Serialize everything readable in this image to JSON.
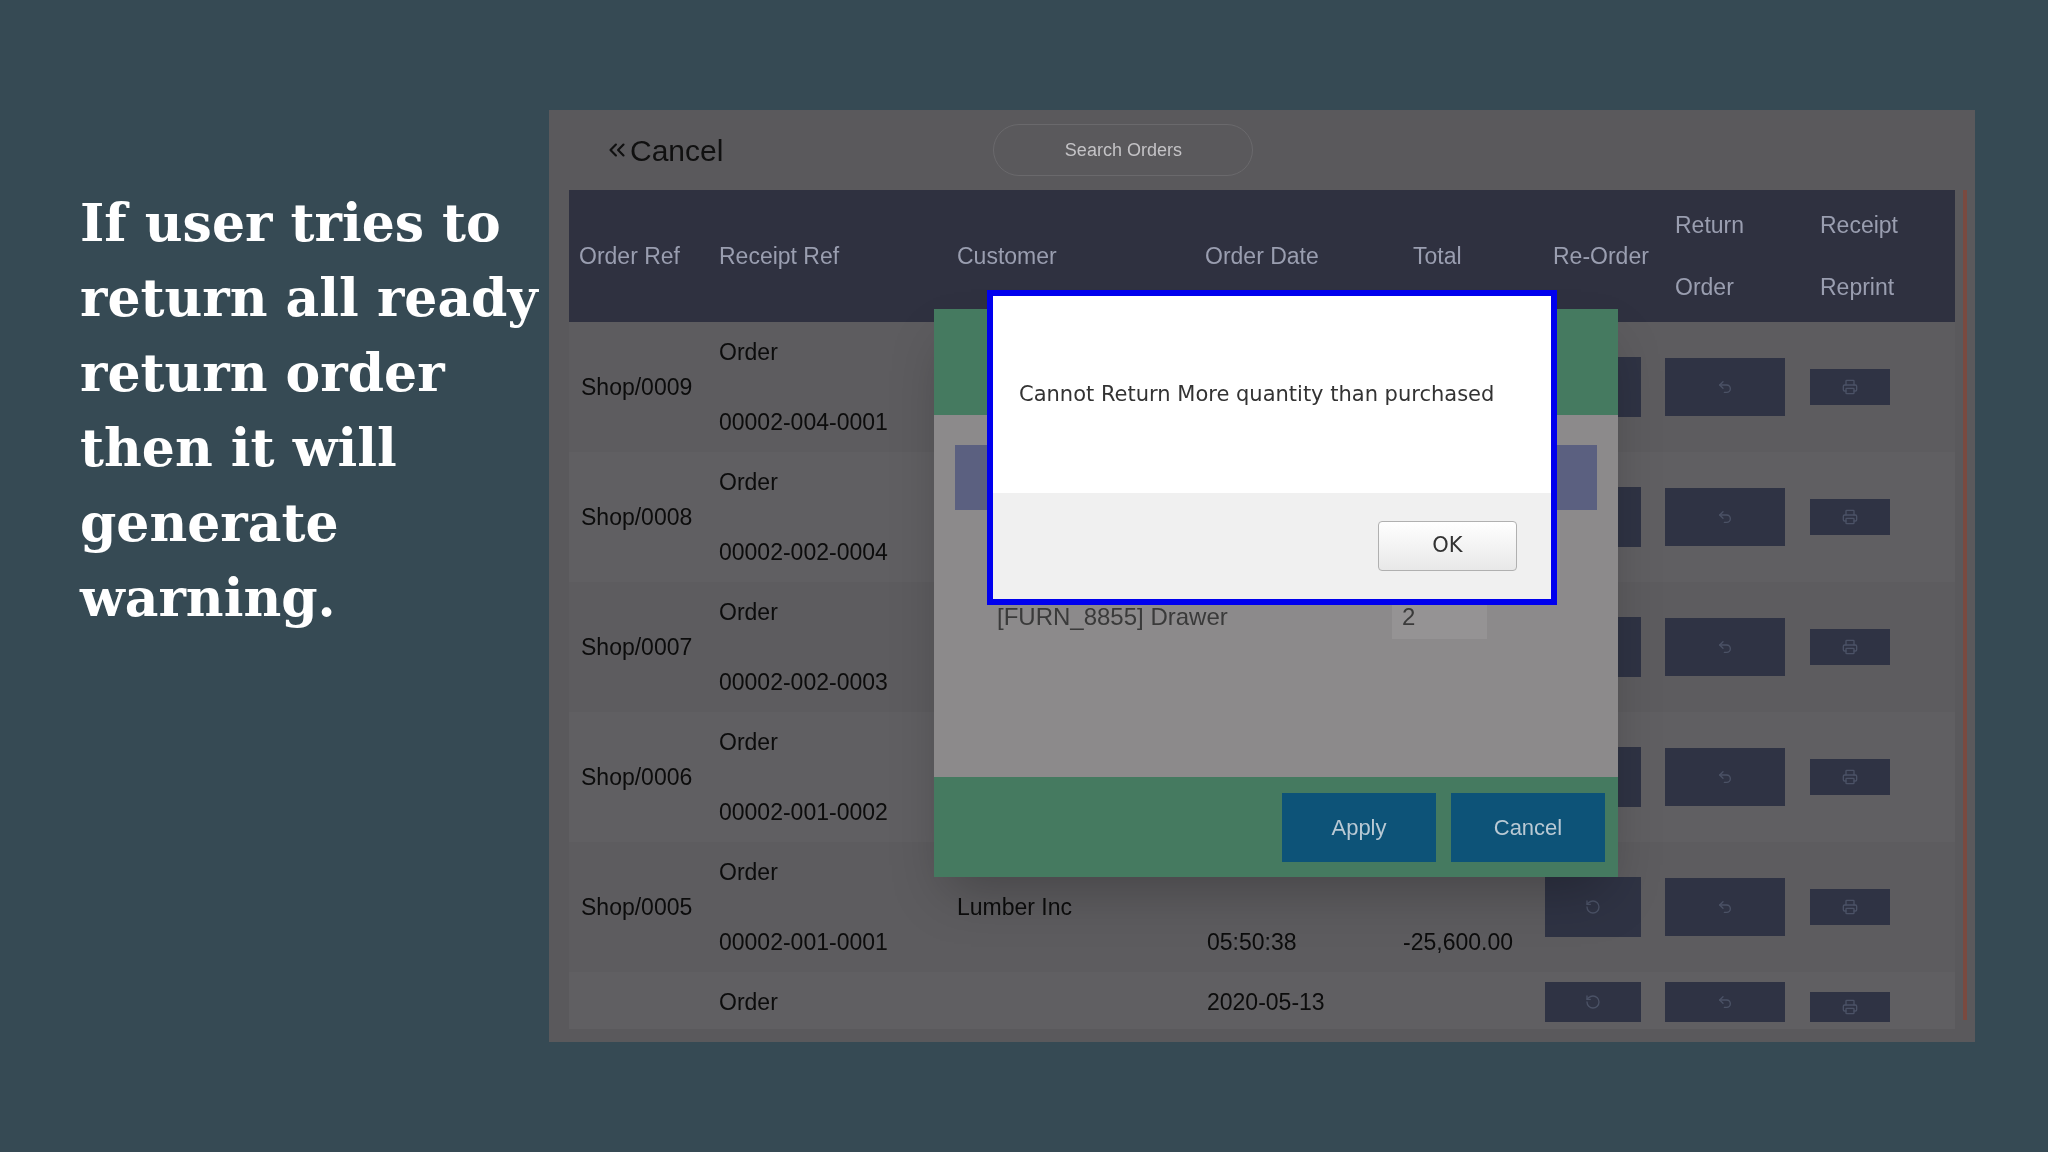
{
  "slide_text": "If user tries to return all ready return order then it will generate warning.",
  "screen": {
    "back_button": "Cancel",
    "search": {
      "placeholder": "Search Orders"
    },
    "table": {
      "columns": [
        "Order Ref",
        "Receipt Ref",
        "Customer",
        "Order Date",
        "Total",
        "Re-Order",
        "Return Order",
        "Receipt Reprint"
      ],
      "rows": [
        {
          "order_ref": "Shop/0009",
          "receipt_ref": [
            "Order",
            "00002-004-0001"
          ]
        },
        {
          "order_ref": "Shop/0008",
          "receipt_ref": [
            "Order",
            "00002-002-0004"
          ]
        },
        {
          "order_ref": "Shop/0007",
          "receipt_ref": [
            "Order",
            "00002-002-0003"
          ]
        },
        {
          "order_ref": "Shop/0006",
          "receipt_ref": [
            "Order",
            "00002-001-0002"
          ]
        },
        {
          "order_ref": "Shop/0005",
          "receipt_ref": [
            "Order",
            "00002-001-0001"
          ],
          "customer": "Lumber Inc",
          "time": "05:50:38",
          "total": "-25,600.00"
        },
        {
          "receipt_ref": [
            "Order"
          ],
          "date": "2020-05-13"
        }
      ]
    },
    "return_dialog": {
      "items": [
        {
          "product": "[FURN_8855] Drawer",
          "quantity": "2"
        }
      ],
      "buttons": [
        "Apply",
        "Cancel"
      ]
    },
    "alert": {
      "message": "Cannot Return More quantity than purchased",
      "button": "OK"
    }
  }
}
